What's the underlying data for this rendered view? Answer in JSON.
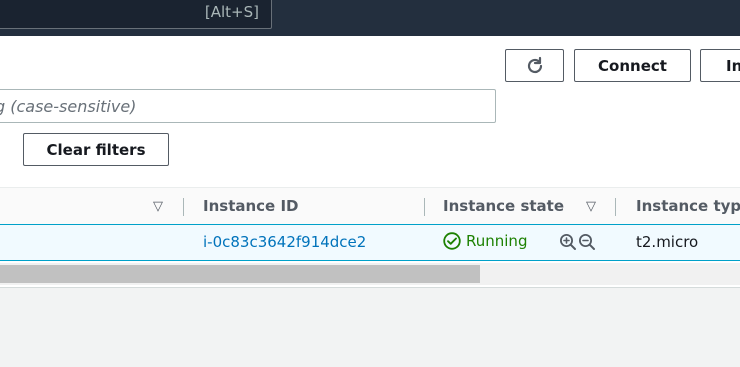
{
  "header": {
    "search_shortcut": "[Alt+S]"
  },
  "toolbar": {
    "refresh_icon": "refresh-icon",
    "connect_label": "Connect",
    "instance_state_label": "In"
  },
  "filter": {
    "placeholder": "g (case-sensitive)",
    "clear_label": "Clear filters"
  },
  "table": {
    "columns": [
      {
        "label": "Instance ID"
      },
      {
        "label": "Instance state"
      },
      {
        "label": "Instance type"
      }
    ],
    "rows": [
      {
        "instance_id": "i-0c83c3642f914dce2",
        "state": "Running",
        "type": "t2.micro"
      }
    ]
  },
  "colors": {
    "accent": "#0073bb",
    "running": "#1d8102",
    "header_bg": "#232f3e"
  }
}
